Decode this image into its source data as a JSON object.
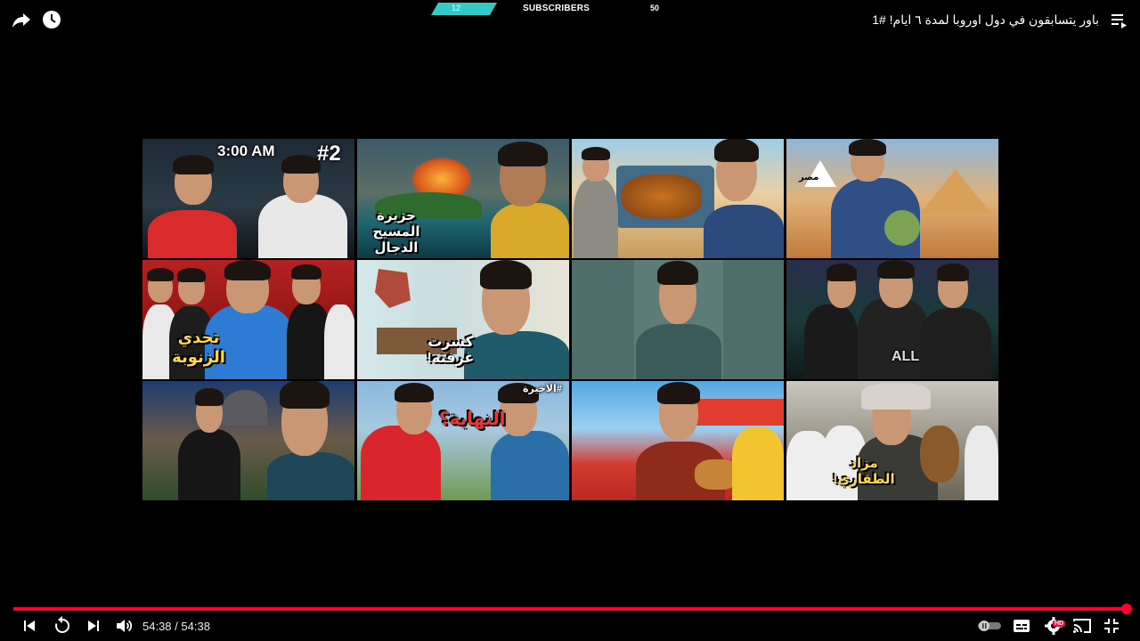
{
  "video": {
    "title": "باور يتسابقون في دول اوروبا لمدة ٦ ايام! #1",
    "current_time": "54:38",
    "duration": "54:38",
    "progress": 1.0,
    "separator": " / "
  },
  "subscribers": {
    "current": "12",
    "label": "SUBSCRIBERS",
    "goal": "50"
  },
  "thumbnails": [
    {
      "caption": "3:00 AM",
      "badge": "#2"
    },
    {
      "caption": "جزيرة المسيح الدجال"
    },
    {
      "caption": ""
    },
    {
      "caption": "مصر"
    },
    {
      "caption": "تحدي الزنوبة"
    },
    {
      "caption": "كسرت غرفته!"
    },
    {
      "caption": ""
    },
    {
      "caption": "ALL"
    },
    {
      "caption": ""
    },
    {
      "caption": "النهاية؟",
      "badge": "#الاخيرة"
    },
    {
      "caption": ""
    },
    {
      "caption": "مزاد الطقاري!"
    }
  ],
  "colors": {
    "progress": "#ff0033",
    "subscriber_bar": "#34c9c7"
  },
  "icons": {
    "top_left": [
      "share-icon",
      "clock-icon"
    ],
    "top_right": "playlist-icon",
    "controls_left": [
      "previous-icon",
      "replay-icon",
      "next-icon",
      "volume-icon"
    ],
    "controls_right": [
      "autoplay-toggle-icon",
      "subtitles-icon",
      "settings-icon",
      "cast-icon",
      "exit-fullscreen-icon"
    ]
  },
  "settings_badge": "HD"
}
